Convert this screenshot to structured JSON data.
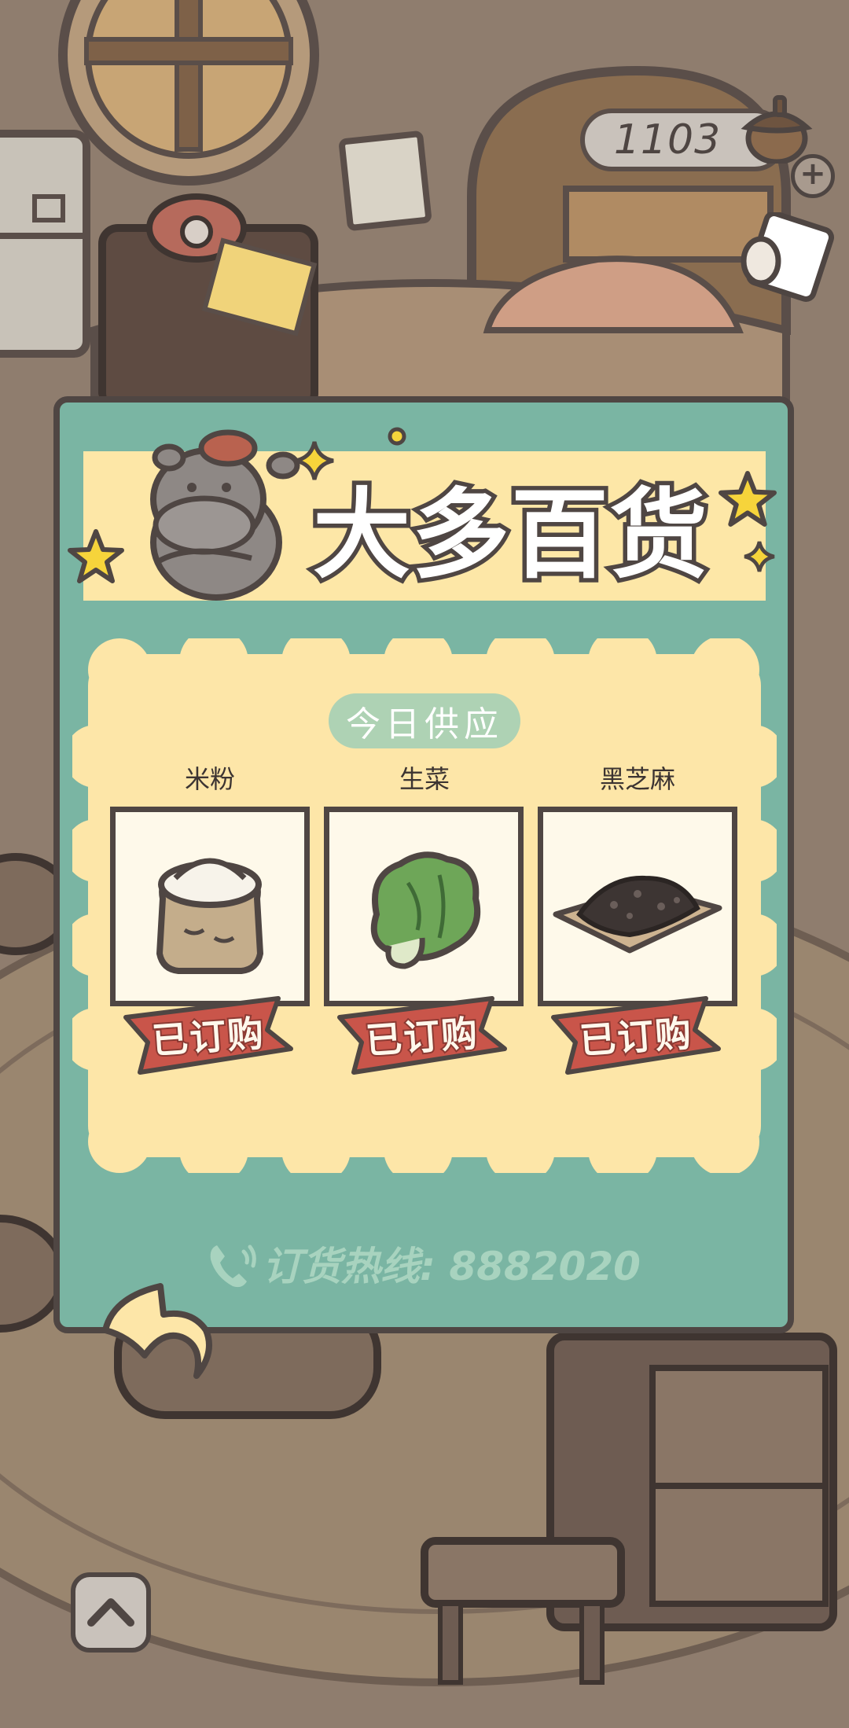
{
  "hud": {
    "coins": "1103",
    "add_coins_label": "+"
  },
  "shop": {
    "title": "大多百货",
    "today_label": "今日供应",
    "hotline": "订货热线: 8882020"
  },
  "items": [
    {
      "name": "米粉",
      "status": "已订购",
      "icon": "rice-flour-sack-icon"
    },
    {
      "name": "生菜",
      "status": "已订购",
      "icon": "lettuce-icon"
    },
    {
      "name": "黑芝麻",
      "status": "已订购",
      "icon": "black-sesame-plate-icon"
    }
  ],
  "colors": {
    "panel_teal": "#7ab5a3",
    "banner_cream": "#fde7a7",
    "supply_cream": "#fde6a8",
    "ribbon_red": "#c9554a",
    "outline": "#4f4643"
  }
}
